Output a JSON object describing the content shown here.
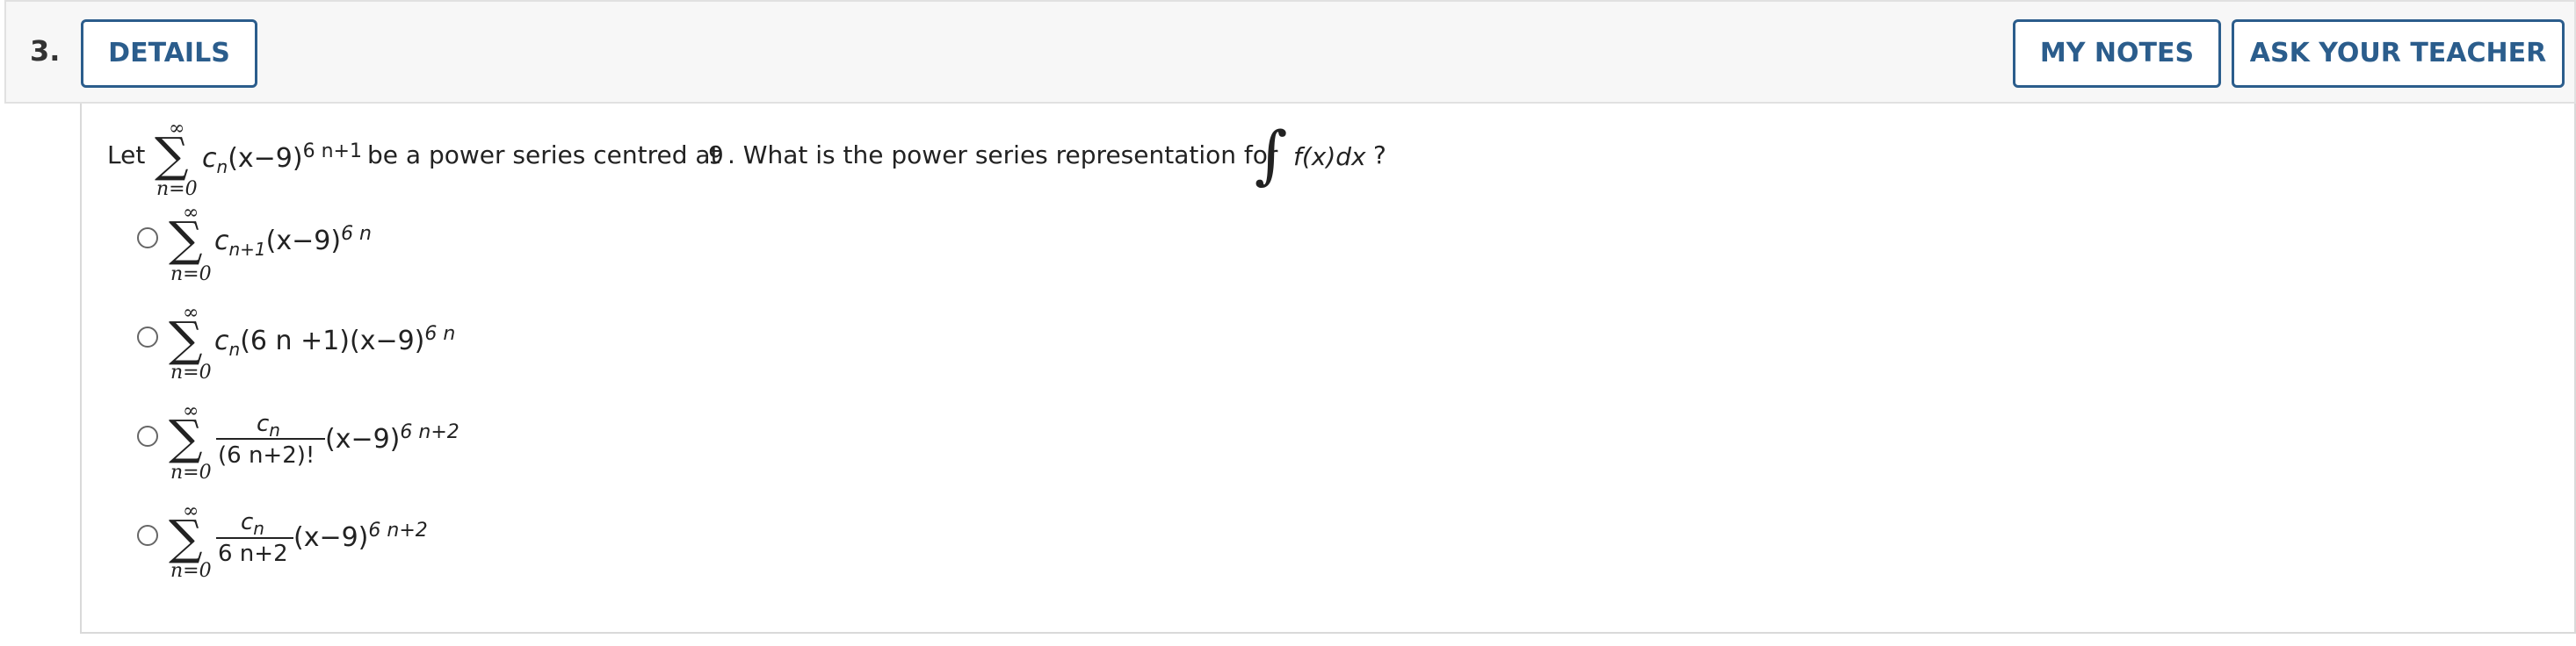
{
  "header": {
    "question_number": "3.",
    "details_label": "DETAILS",
    "my_notes_label": "MY NOTES",
    "ask_teacher_label": "ASK YOUR TEACHER"
  },
  "question": {
    "let": "Let",
    "sum_upper": "∞",
    "sum_lower": "n=0",
    "series_coef": "c",
    "series_coef_sub": "n",
    "series_base": "(x−9)",
    "series_exp": "6 n+1",
    "be_text": "be a power series centred at",
    "center": "9",
    "question_text": ". What is the power series representation for",
    "integrand": "f(x)dx",
    "question_mark": "?"
  },
  "options": [
    {
      "sum_upper": "∞",
      "sum_lower": "n=0",
      "coef": "c",
      "coef_sub": "n+1",
      "base": "(x−9)",
      "exp": "6 n"
    },
    {
      "sum_upper": "∞",
      "sum_lower": "n=0",
      "coef": "c",
      "coef_sub": "n",
      "factor": "(6 n +1)",
      "base": "(x−9)",
      "exp": "6 n"
    },
    {
      "sum_upper": "∞",
      "sum_lower": "n=0",
      "num": "c",
      "num_sub": "n",
      "den": "(6 n+2)!",
      "base": "(x−9)",
      "exp": "6 n+2"
    },
    {
      "sum_upper": "∞",
      "sum_lower": "n=0",
      "num": "c",
      "num_sub": "n",
      "den": "6 n+2",
      "base": "(x−9)",
      "exp": "6 n+2"
    }
  ]
}
